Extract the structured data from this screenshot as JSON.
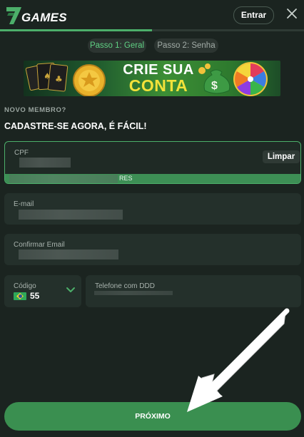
{
  "header": {
    "logo_text": "GAMES",
    "logo_mark": "7",
    "login_label": "Entrar",
    "close_icon": "close-icon"
  },
  "progress": {
    "fraction": 0.5
  },
  "steps": [
    {
      "label": "Passo 1: Geral",
      "active": true
    },
    {
      "label": "Passo 2: Senha",
      "active": false
    }
  ],
  "banner": {
    "line1": "CRIE SUA",
    "line2": "CONTA"
  },
  "form": {
    "eyebrow": "NOVO MEMBRO?",
    "headline": "CADASTRE-SE AGORA, É FÁCIL!",
    "cpf": {
      "label": "CPF",
      "clear_label": "Limpar",
      "hint_suffix": "RES"
    },
    "email": {
      "label": "E-mail"
    },
    "confirm_email": {
      "label": "Confirmar Email"
    },
    "country_code": {
      "label": "Código",
      "value": "55",
      "flag": "brazil-flag"
    },
    "phone": {
      "label": "Telefone com DDD"
    }
  },
  "submit_label": "PRÓXIMO",
  "colors": {
    "accent": "#4caf6a",
    "background": "#1b2420",
    "field": "#24302b",
    "button": "#3a8f50"
  }
}
